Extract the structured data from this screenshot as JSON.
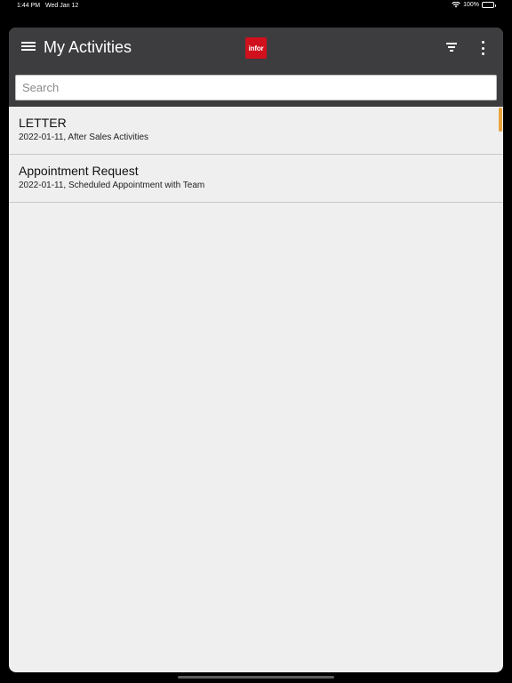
{
  "status_bar": {
    "time": "1:44 PM",
    "date": "Wed Jan 12",
    "battery": "100%",
    "wifi_icon": "wifi-icon",
    "battery_icon": "battery-icon"
  },
  "app_bar": {
    "title": "My Activities",
    "logo_text": "infor",
    "brand_color": "#d0101c",
    "bar_color": "#3d3d3f"
  },
  "search": {
    "placeholder": "Search",
    "value": ""
  },
  "activities": [
    {
      "title": "LETTER",
      "subtitle": "2022-01-11, After Sales Activities"
    },
    {
      "title": "Appointment Request",
      "subtitle": "2022-01-11, Scheduled Appointment with Team"
    }
  ],
  "accent_color": "#e8a33c"
}
